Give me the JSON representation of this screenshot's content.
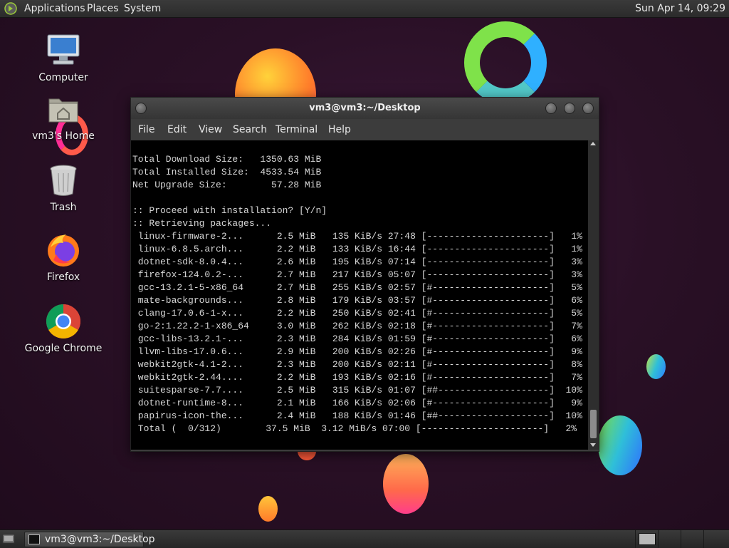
{
  "top_panel": {
    "menus": [
      "Applications",
      "Places",
      "System"
    ],
    "clock": "Sun Apr 14, 09:29"
  },
  "desktop_icons": [
    {
      "label": "Computer",
      "icon": "computer-icon"
    },
    {
      "label": "vm3's Home",
      "icon": "home-folder-icon"
    },
    {
      "label": "Trash",
      "icon": "trash-icon"
    },
    {
      "label": "Firefox",
      "icon": "firefox-icon"
    },
    {
      "label": "Google Chrome",
      "icon": "chrome-icon"
    }
  ],
  "terminal": {
    "title": "vm3@vm3:~/Desktop",
    "menu": [
      "File",
      "Edit",
      "View",
      "Search",
      "Terminal",
      "Help"
    ],
    "lines": [
      "Total Download Size:   1350.63 MiB",
      "Total Installed Size:  4533.54 MiB",
      "Net Upgrade Size:        57.28 MiB",
      "",
      ":: Proceed with installation? [Y/n]",
      ":: Retrieving packages...",
      " linux-firmware-2...      2.5 MiB   135 KiB/s 27:48 [----------------------]   1%",
      " linux-6.8.5.arch...      2.2 MiB   133 KiB/s 16:44 [----------------------]   1%",
      " dotnet-sdk-8.0.4...      2.6 MiB   195 KiB/s 07:14 [----------------------]   3%",
      " firefox-124.0.2-...      2.7 MiB   217 KiB/s 05:07 [----------------------]   3%",
      " gcc-13.2.1-5-x86_64      2.7 MiB   255 KiB/s 02:57 [#---------------------]   5%",
      " mate-backgrounds...      2.8 MiB   179 KiB/s 03:57 [#---------------------]   6%",
      " clang-17.0.6-1-x...      2.2 MiB   250 KiB/s 02:41 [#---------------------]   5%",
      " go-2:1.22.2-1-x86_64     3.0 MiB   262 KiB/s 02:18 [#---------------------]   7%",
      " gcc-libs-13.2.1-...      2.3 MiB   284 KiB/s 01:59 [#---------------------]   6%",
      " llvm-libs-17.0.6...      2.9 MiB   200 KiB/s 02:26 [#---------------------]   9%",
      " webkit2gtk-4.1-2...      2.3 MiB   200 KiB/s 02:11 [#---------------------]   8%",
      " webkit2gtk-2.44....      2.2 MiB   193 KiB/s 02:16 [#---------------------]   7%",
      " suitesparse-7.7....      2.5 MiB   315 KiB/s 01:07 [##--------------------]  10%",
      " dotnet-runtime-8...      2.1 MiB   166 KiB/s 02:06 [#---------------------]   9%",
      " papirus-icon-the...      2.4 MiB   188 KiB/s 01:46 [##--------------------]  10%",
      " Total (  0/312)        37.5 MiB  3.12 MiB/s 07:00 [----------------------]   2%"
    ]
  },
  "taskbar": {
    "task_label": "vm3@vm3:~/Desktop"
  }
}
